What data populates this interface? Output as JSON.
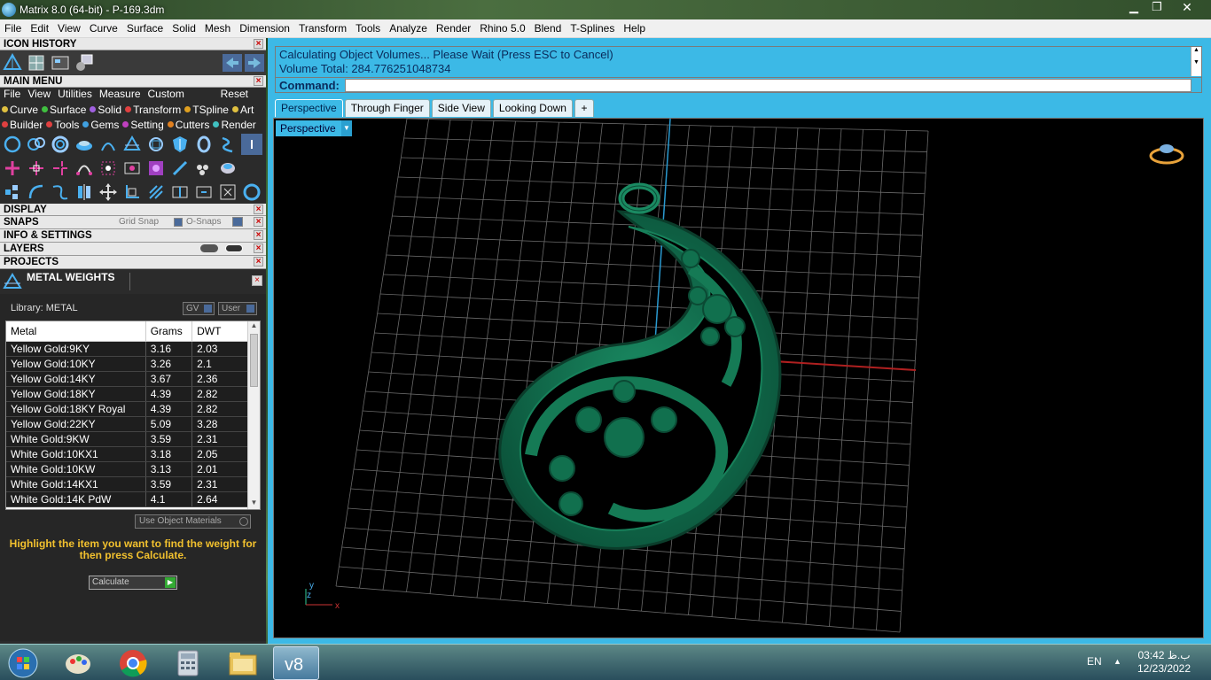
{
  "window": {
    "title": "Matrix 8.0 (64-bit) - P-169.3dm",
    "minimize": "▁",
    "maximize": "❐",
    "close": "✕"
  },
  "menubar": [
    "File",
    "Edit",
    "View",
    "Curve",
    "Surface",
    "Solid",
    "Mesh",
    "Dimension",
    "Transform",
    "Tools",
    "Analyze",
    "Render",
    "Rhino 5.0",
    "Blend",
    "T-Splines",
    "Help"
  ],
  "panels": {
    "icon_history": "ICON HISTORY",
    "main_menu": "MAIN MENU",
    "main_submenu": [
      "File",
      "View",
      "Utilities",
      "Measure",
      "Custom"
    ],
    "reset": "Reset",
    "categories_row1": [
      {
        "label": "Curve",
        "color": "#e0c040"
      },
      {
        "label": "Surface",
        "color": "#40c040"
      },
      {
        "label": "Solid",
        "color": "#a060e0"
      },
      {
        "label": "Transform",
        "color": "#e04040"
      },
      {
        "label": "TSpline",
        "color": "#e0a020"
      },
      {
        "label": "Art",
        "color": "#e0c040"
      }
    ],
    "categories_row2": [
      {
        "label": "Builder",
        "color": "#e04040"
      },
      {
        "label": "Tools",
        "color": "#e04040"
      },
      {
        "label": "Gems",
        "color": "#40a0e0"
      },
      {
        "label": "Setting",
        "color": "#c040c0"
      },
      {
        "label": "Cutters",
        "color": "#e08020"
      },
      {
        "label": "Render",
        "color": "#40c0c0"
      }
    ],
    "display": "DISPLAY",
    "snaps": "SNAPS",
    "grid_snap": "Grid Snap",
    "o_snaps": "O-Snaps",
    "info_settings": "INFO & SETTINGS",
    "layers": "LAYERS",
    "projects": "PROJECTS",
    "metal_weights": "METAL WEIGHTS"
  },
  "metal": {
    "library_label": "Library: METAL",
    "gv": "GV",
    "user": "User",
    "columns": [
      "Metal",
      "Grams",
      "DWT"
    ],
    "rows": [
      [
        "Yellow Gold:9KY",
        "3.16",
        "2.03"
      ],
      [
        "Yellow Gold:10KY",
        "3.26",
        "2.1"
      ],
      [
        "Yellow Gold:14KY",
        "3.67",
        "2.36"
      ],
      [
        "Yellow Gold:18KY",
        "4.39",
        "2.82"
      ],
      [
        "Yellow Gold:18KY Royal",
        "4.39",
        "2.82"
      ],
      [
        "Yellow Gold:22KY",
        "5.09",
        "3.28"
      ],
      [
        "White Gold:9KW",
        "3.59",
        "2.31"
      ],
      [
        "White Gold:10KX1",
        "3.18",
        "2.05"
      ],
      [
        "White Gold:10KW",
        "3.13",
        "2.01"
      ],
      [
        "White Gold:14KX1",
        "3.59",
        "2.31"
      ],
      [
        "White Gold:14K PdW",
        "4.1",
        "2.64"
      ]
    ],
    "use_object_materials": "Use Object Materials",
    "hint": "Highlight the item you want to find the weight for then press Calculate.",
    "calculate": "Calculate"
  },
  "command": {
    "line1": "Calculating Object Volumes... Please Wait (Press ESC to Cancel)",
    "line2": "Volume Total: 284.776251048734",
    "label": "Command:",
    "value": ""
  },
  "viewport_tabs": [
    "Perspective",
    "Through Finger",
    "Side View",
    "Looking Down"
  ],
  "viewport_add": "+",
  "viewport_name": "Perspective",
  "axis_labels": {
    "y": "y",
    "z": "z",
    "x": "x"
  },
  "taskbar": {
    "lang": "EN",
    "time": "03:42 ب.ظ",
    "date": "12/23/2022"
  },
  "colors": {
    "accent": "#3cb9e6",
    "model": "#0f6b4a",
    "grid": "#6a6a6a",
    "hint": "#f2c12e"
  }
}
